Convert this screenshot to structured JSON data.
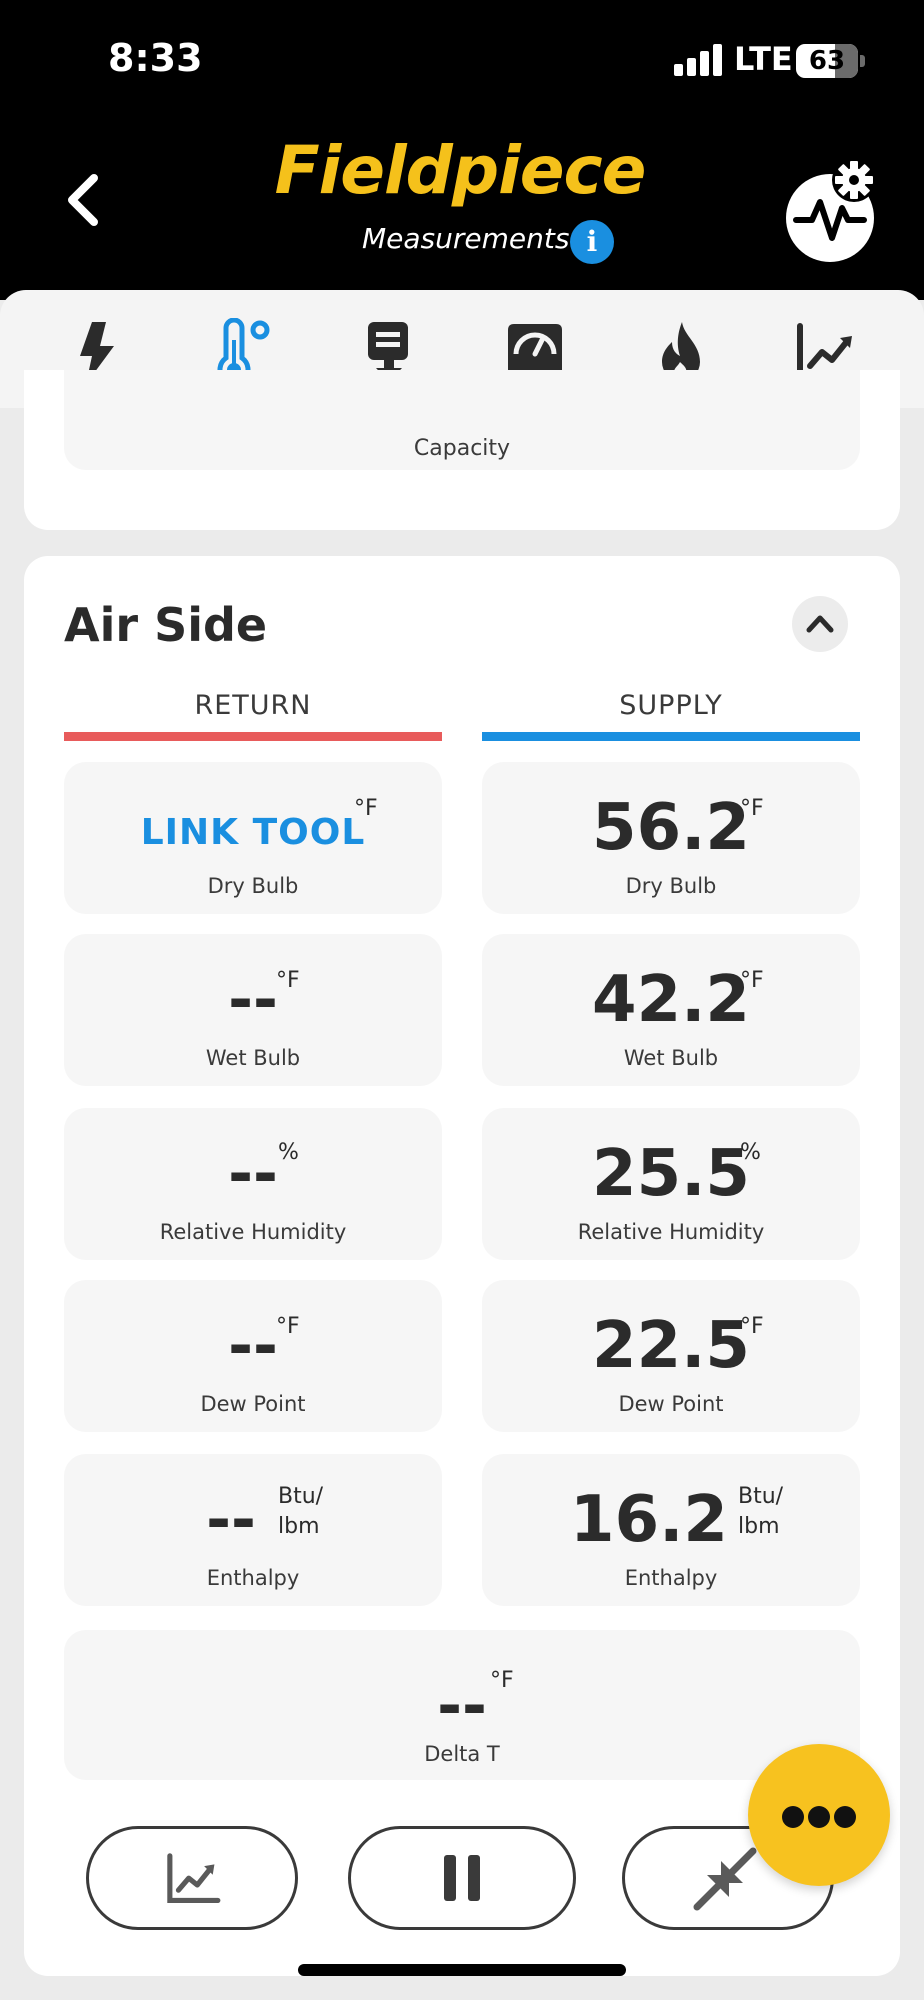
{
  "status_bar": {
    "time": "8:33",
    "network": "LTE",
    "battery": "63"
  },
  "header": {
    "brand": "Fieldpiece",
    "subtitle": "Measurements",
    "info_glyph": "i"
  },
  "tabs": [
    {
      "icon": "lightning-icon",
      "active": false
    },
    {
      "icon": "thermometer-icon",
      "active": true
    },
    {
      "icon": "download-icon",
      "active": false
    },
    {
      "icon": "gauge-icon",
      "active": false
    },
    {
      "icon": "flame-icon",
      "active": false
    },
    {
      "icon": "chart-icon",
      "active": false
    }
  ],
  "capacity": {
    "label": "Capacity"
  },
  "air_side": {
    "title": "Air Side",
    "return": {
      "header": "RETURN",
      "color": "#e85b5b",
      "dry_bulb": {
        "value": "LINK TOOL",
        "unit": "°F",
        "label": "Dry Bulb"
      },
      "wet_bulb": {
        "value": "--",
        "unit": "°F",
        "label": "Wet Bulb"
      },
      "relative_humidity": {
        "value": "--",
        "unit": "%",
        "label": "Relative Humidity"
      },
      "dew_point": {
        "value": "--",
        "unit": "°F",
        "label": "Dew Point"
      },
      "enthalpy": {
        "value": "--",
        "unit_line1": "Btu/",
        "unit_line2": "lbm",
        "label": "Enthalpy"
      }
    },
    "supply": {
      "header": "SUPPLY",
      "color": "#1a8fe0",
      "dry_bulb": {
        "value": "56.2",
        "unit": "°F",
        "label": "Dry Bulb"
      },
      "wet_bulb": {
        "value": "42.2",
        "unit": "°F",
        "label": "Wet Bulb"
      },
      "relative_humidity": {
        "value": "25.5",
        "unit": "%",
        "label": "Relative Humidity"
      },
      "dew_point": {
        "value": "22.5",
        "unit": "°F",
        "label": "Dew Point"
      },
      "enthalpy": {
        "value": "16.2",
        "unit_line1": "Btu/",
        "unit_line2": "lbm",
        "label": "Enthalpy"
      }
    },
    "delta_t": {
      "value": "--",
      "unit": "°F",
      "label": "Delta T"
    }
  },
  "actions": {
    "graph": "chart-icon",
    "pause": "pause-icon",
    "collapse": "collapse-arrows-icon",
    "more": "more-icon"
  },
  "colors": {
    "brand": "#f5c11b",
    "accent": "#1a8fe0",
    "return": "#e85b5b",
    "fab": "#f7c21f"
  }
}
